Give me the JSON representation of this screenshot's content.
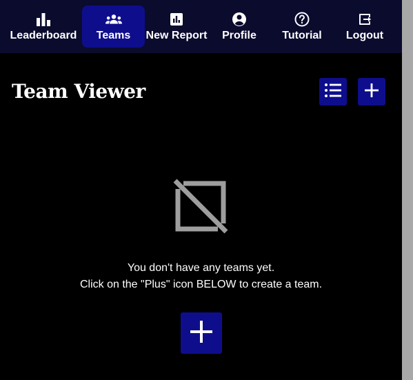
{
  "nav": {
    "items": [
      {
        "label": "Leaderboard",
        "icon": "bar-chart-icon"
      },
      {
        "label": "Teams",
        "icon": "groups-icon",
        "active": true
      },
      {
        "label": "New Report",
        "icon": "report-icon"
      },
      {
        "label": "Profile",
        "icon": "account-circle-icon"
      },
      {
        "label": "Tutorial",
        "icon": "help-circle-icon"
      },
      {
        "label": "Logout",
        "icon": "logout-icon"
      }
    ]
  },
  "header": {
    "title": "Team Viewer",
    "list_button_icon": "list-icon",
    "add_button_icon": "plus-icon"
  },
  "empty_state": {
    "icon": "no-image-icon",
    "line1": "You don't have any teams yet.",
    "line2": "Click on the \"Plus\" icon BELOW to create a team.",
    "add_button_icon": "plus-icon"
  },
  "colors": {
    "nav_bg": "#0b0b2e",
    "accent": "#0e0e8c",
    "background": "#000000",
    "empty_icon": "#9e9e9e"
  }
}
